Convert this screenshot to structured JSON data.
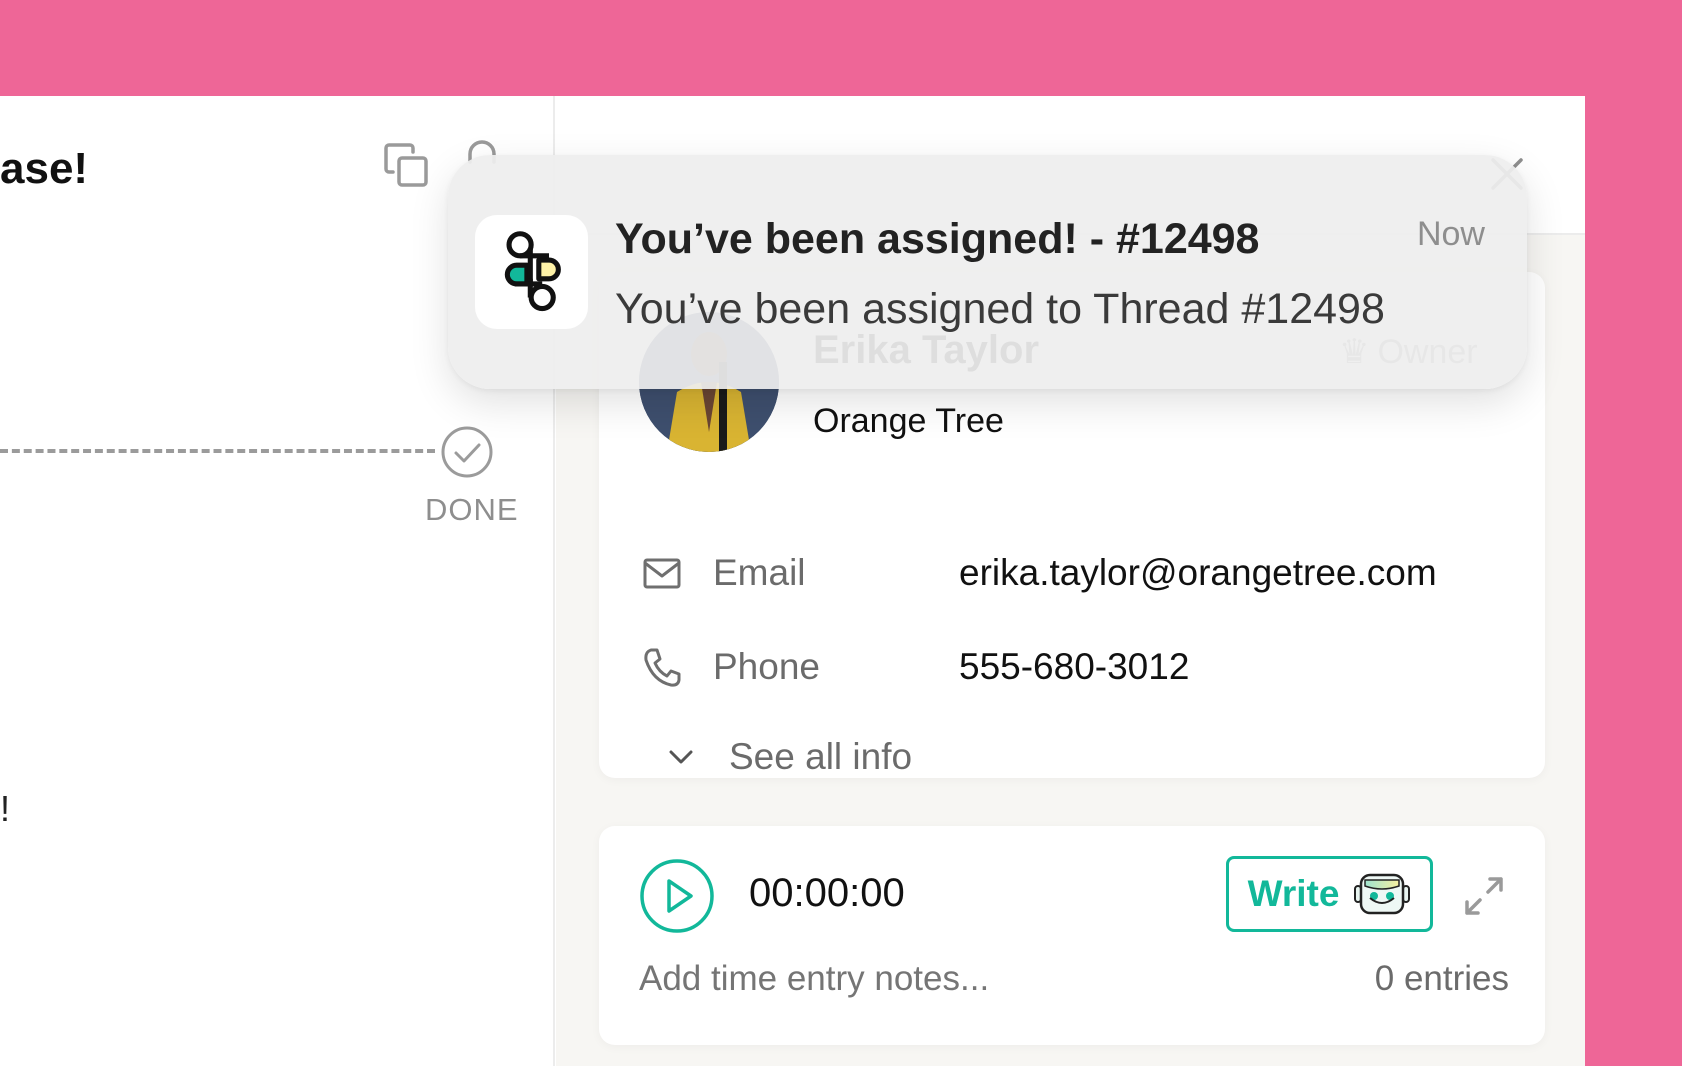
{
  "colors": {
    "background": "#ee6697",
    "accent": "#12b89a",
    "muted_text": "#6b6b6b",
    "app_icon_green": "#12b89a",
    "app_icon_yellow": "#fff3a8"
  },
  "thread": {
    "title_fragment": "ase!",
    "copy_icon": "copy-icon",
    "lock_icon": "lock-icon",
    "status_label": "DONE",
    "status_icon": "check-circle-icon",
    "message_fragment": "!"
  },
  "right_panel": {
    "close_icon": "close-icon"
  },
  "contact": {
    "name": "Erika Taylor",
    "role_badge": "Owner",
    "company": "Orange Tree",
    "fields": [
      {
        "icon": "mail-icon",
        "label": "Email",
        "value": "erika.taylor@orangetree.com"
      },
      {
        "icon": "phone-icon",
        "label": "Phone",
        "value": "555-680-3012"
      }
    ],
    "see_all_label": "See all info"
  },
  "time_tracker": {
    "timer": "00:00:00",
    "write_label": "Write",
    "notes_placeholder": "Add time entry notes...",
    "notes_value": "",
    "entries_count": "0 entries"
  },
  "notification": {
    "title": "You’ve been assigned! - #12498",
    "body": "You’ve been assigned to Thread #12498",
    "time": "Now",
    "app_icon": "app-logo-icon"
  }
}
